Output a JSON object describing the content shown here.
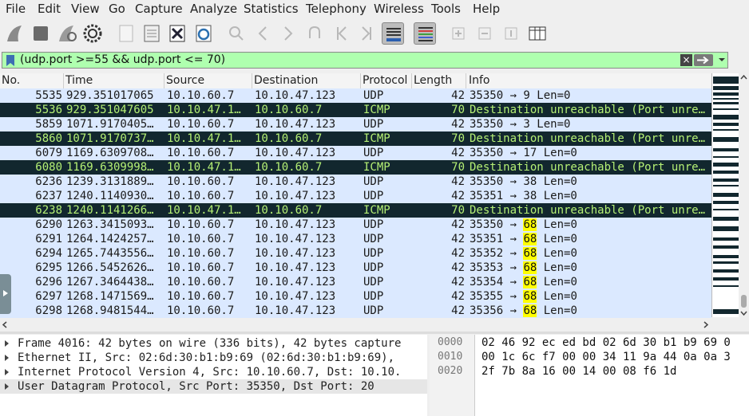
{
  "menu": [
    "File",
    "Edit",
    "View",
    "Go",
    "Capture",
    "Analyze",
    "Statistics",
    "Telephony",
    "Wireless",
    "Tools",
    "Help"
  ],
  "filter": {
    "text": "(udp.port >=55 && udp.port <= 70)",
    "clear_label": "×"
  },
  "columns": [
    "No.",
    "Time",
    "Source",
    "Destination",
    "Protocol",
    "Length",
    "Info"
  ],
  "packets": [
    {
      "no": "5535",
      "time": "929.351017065",
      "src": "10.10.60.7",
      "dst": "10.10.47.123",
      "proto": "UDP",
      "len": "42",
      "info": "35350 → 9 Len=0",
      "type": "udp"
    },
    {
      "no": "5536",
      "time": "929.351047605",
      "src": "10.10.47.1…",
      "dst": "10.10.60.7",
      "proto": "ICMP",
      "len": "70",
      "info": "Destination unreachable (Port unre…",
      "type": "icmp"
    },
    {
      "no": "5859",
      "time": "1071.9170405…",
      "src": "10.10.60.7",
      "dst": "10.10.47.123",
      "proto": "UDP",
      "len": "42",
      "info": "35350 → 3 Len=0",
      "type": "udp"
    },
    {
      "no": "5860",
      "time": "1071.9170737…",
      "src": "10.10.47.1…",
      "dst": "10.10.60.7",
      "proto": "ICMP",
      "len": "70",
      "info": "Destination unreachable (Port unre…",
      "type": "icmp"
    },
    {
      "no": "6079",
      "time": "1169.6309708…",
      "src": "10.10.60.7",
      "dst": "10.10.47.123",
      "proto": "UDP",
      "len": "42",
      "info": "35350 → 17 Len=0",
      "type": "udp"
    },
    {
      "no": "6080",
      "time": "1169.6309998…",
      "src": "10.10.47.1…",
      "dst": "10.10.60.7",
      "proto": "ICMP",
      "len": "70",
      "info": "Destination unreachable (Port unre…",
      "type": "icmp"
    },
    {
      "no": "6236",
      "time": "1239.3131889…",
      "src": "10.10.60.7",
      "dst": "10.10.47.123",
      "proto": "UDP",
      "len": "42",
      "info": "35350 → 38 Len=0",
      "type": "udp"
    },
    {
      "no": "6237",
      "time": "1240.1140930…",
      "src": "10.10.60.7",
      "dst": "10.10.47.123",
      "proto": "UDP",
      "len": "42",
      "info": "35351 → 38 Len=0",
      "type": "udp"
    },
    {
      "no": "6238",
      "time": "1240.1141266…",
      "src": "10.10.47.1…",
      "dst": "10.10.60.7",
      "proto": "ICMP",
      "len": "70",
      "info": "Destination unreachable (Port unre…",
      "type": "icmp"
    },
    {
      "no": "6290",
      "time": "1263.3415093…",
      "src": "10.10.60.7",
      "dst": "10.10.47.123",
      "proto": "UDP",
      "len": "42",
      "info_pre": "35350 → ",
      "info_hl": "68",
      "info_post": " Len=0",
      "type": "udp"
    },
    {
      "no": "6291",
      "time": "1264.1424257…",
      "src": "10.10.60.7",
      "dst": "10.10.47.123",
      "proto": "UDP",
      "len": "42",
      "info_pre": "35351 → ",
      "info_hl": "68",
      "info_post": " Len=0",
      "type": "udp"
    },
    {
      "no": "6294",
      "time": "1265.7443556…",
      "src": "10.10.60.7",
      "dst": "10.10.47.123",
      "proto": "UDP",
      "len": "42",
      "info_pre": "35352 → ",
      "info_hl": "68",
      "info_post": " Len=0",
      "type": "udp"
    },
    {
      "no": "6295",
      "time": "1266.5452626…",
      "src": "10.10.60.7",
      "dst": "10.10.47.123",
      "proto": "UDP",
      "len": "42",
      "info_pre": "35353 → ",
      "info_hl": "68",
      "info_post": " Len=0",
      "type": "udp"
    },
    {
      "no": "6296",
      "time": "1267.3464438…",
      "src": "10.10.60.7",
      "dst": "10.10.47.123",
      "proto": "UDP",
      "len": "42",
      "info_pre": "35354 → ",
      "info_hl": "68",
      "info_post": " Len=0",
      "type": "udp"
    },
    {
      "no": "6297",
      "time": "1268.1471569…",
      "src": "10.10.60.7",
      "dst": "10.10.47.123",
      "proto": "UDP",
      "len": "42",
      "info_pre": "35355 → ",
      "info_hl": "68",
      "info_post": " Len=0",
      "type": "udp"
    },
    {
      "no": "6298",
      "time": "1268.9481544…",
      "src": "10.10.60.7",
      "dst": "10.10.47.123",
      "proto": "UDP",
      "len": "42",
      "info_pre": "35356 → ",
      "info_hl": "68",
      "info_post": " Len=0",
      "type": "udp"
    }
  ],
  "details": [
    "Frame 4016: 42 bytes on wire (336 bits), 42 bytes capture",
    "Ethernet II, Src: 02:6d:30:b1:b9:69 (02:6d:30:b1:b9:69),",
    "Internet Protocol Version 4, Src: 10.10.60.7, Dst: 10.10.",
    "User Datagram Protocol, Src Port: 35350, Dst Port: 20"
  ],
  "bytes": [
    {
      "offset": "0000",
      "hex": "02 46 92 ec ed bd 02 6d  30 b1 b9 69 0"
    },
    {
      "offset": "0010",
      "hex": "00 1c 6c f7 00 00 34 11  9a 44 0a 0a 3"
    },
    {
      "offset": "0020",
      "hex": "2f 7b 8a 16 00 14 00 08  f6 1d"
    }
  ],
  "colors": {
    "udp_row": "#dbe9ff",
    "icmp_row": "#12272e",
    "icmp_text": "#b5f075",
    "filter_ok": "#afffaf",
    "match_highlight": "#ffff00"
  }
}
